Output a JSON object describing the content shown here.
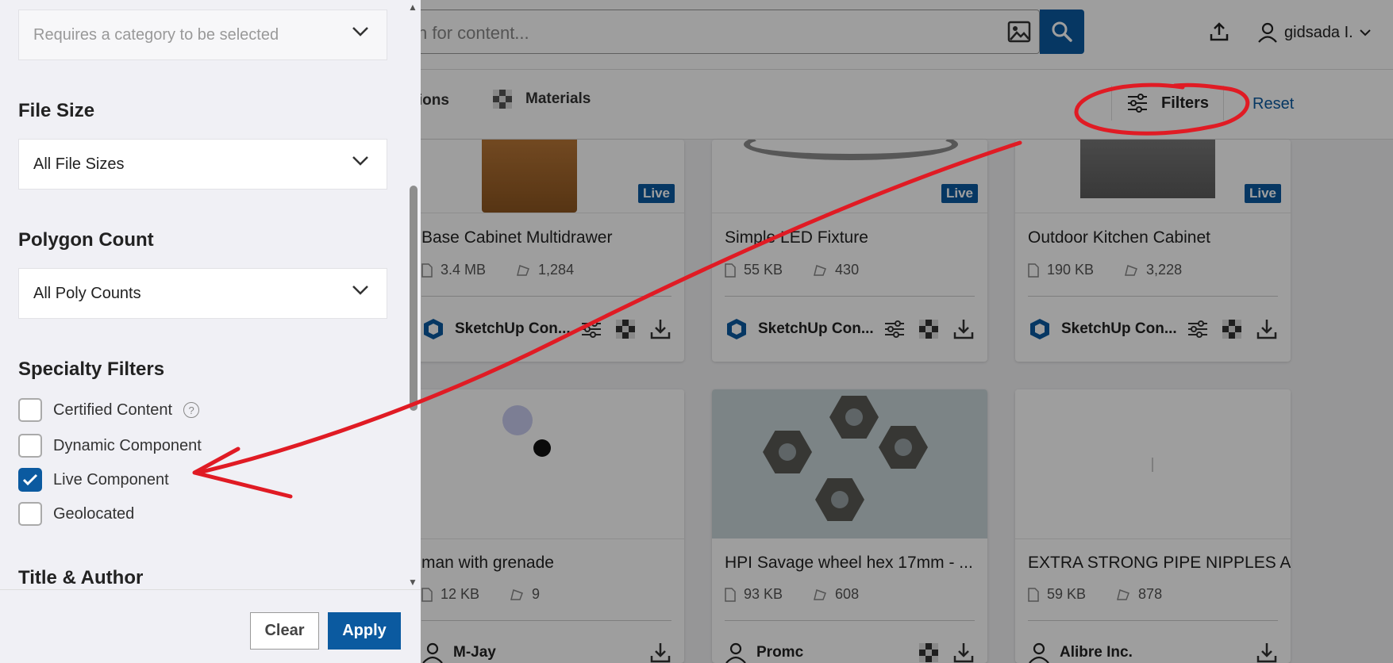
{
  "header": {
    "search_placeholder": "ch for content...",
    "user_name": "gidsada I."
  },
  "toolbar": {
    "collections_label": "ctions",
    "materials_label": "Materials",
    "filters_label": "Filters",
    "reset_label": "Reset"
  },
  "cards": [
    {
      "title": "Base Cabinet Multidrawer",
      "size": "3.4 MB",
      "polys": "1,284",
      "author": "SketchUp Con...",
      "live": "Live"
    },
    {
      "title": "Simple LED Fixture",
      "size": "55 KB",
      "polys": "430",
      "author": "SketchUp Con...",
      "live": "Live"
    },
    {
      "title": "Outdoor Kitchen Cabinet",
      "size": "190 KB",
      "polys": "3,228",
      "author": "SketchUp Con...",
      "live": "Live"
    },
    {
      "title": "man with grenade",
      "size": "12 KB",
      "polys": "9",
      "author": "M-Jay"
    },
    {
      "title": "HPI Savage wheel hex 17mm - ...",
      "size": "93 KB",
      "polys": "608",
      "author": "Promc"
    },
    {
      "title": "EXTRA STRONG PIPE NIPPLES A...",
      "size": "59 KB",
      "polys": "878",
      "author": "Alibre Inc."
    }
  ],
  "panel": {
    "subcategory_placeholder": "Requires a category to be selected",
    "file_size": {
      "title": "File Size",
      "value": "All File Sizes"
    },
    "polygon_count": {
      "title": "Polygon Count",
      "value": "All Poly Counts"
    },
    "specialty": {
      "title": "Specialty Filters",
      "options": [
        {
          "label": "Certified Content",
          "checked": false
        },
        {
          "label": "Dynamic Component",
          "checked": false
        },
        {
          "label": "Live Component",
          "checked": true
        },
        {
          "label": "Geolocated",
          "checked": false
        }
      ]
    },
    "title_author": {
      "title": "Title & Author"
    },
    "clear_label": "Clear",
    "apply_label": "Apply"
  },
  "colors": {
    "accent": "#0b5aa0",
    "annotation": "#e01b24"
  }
}
